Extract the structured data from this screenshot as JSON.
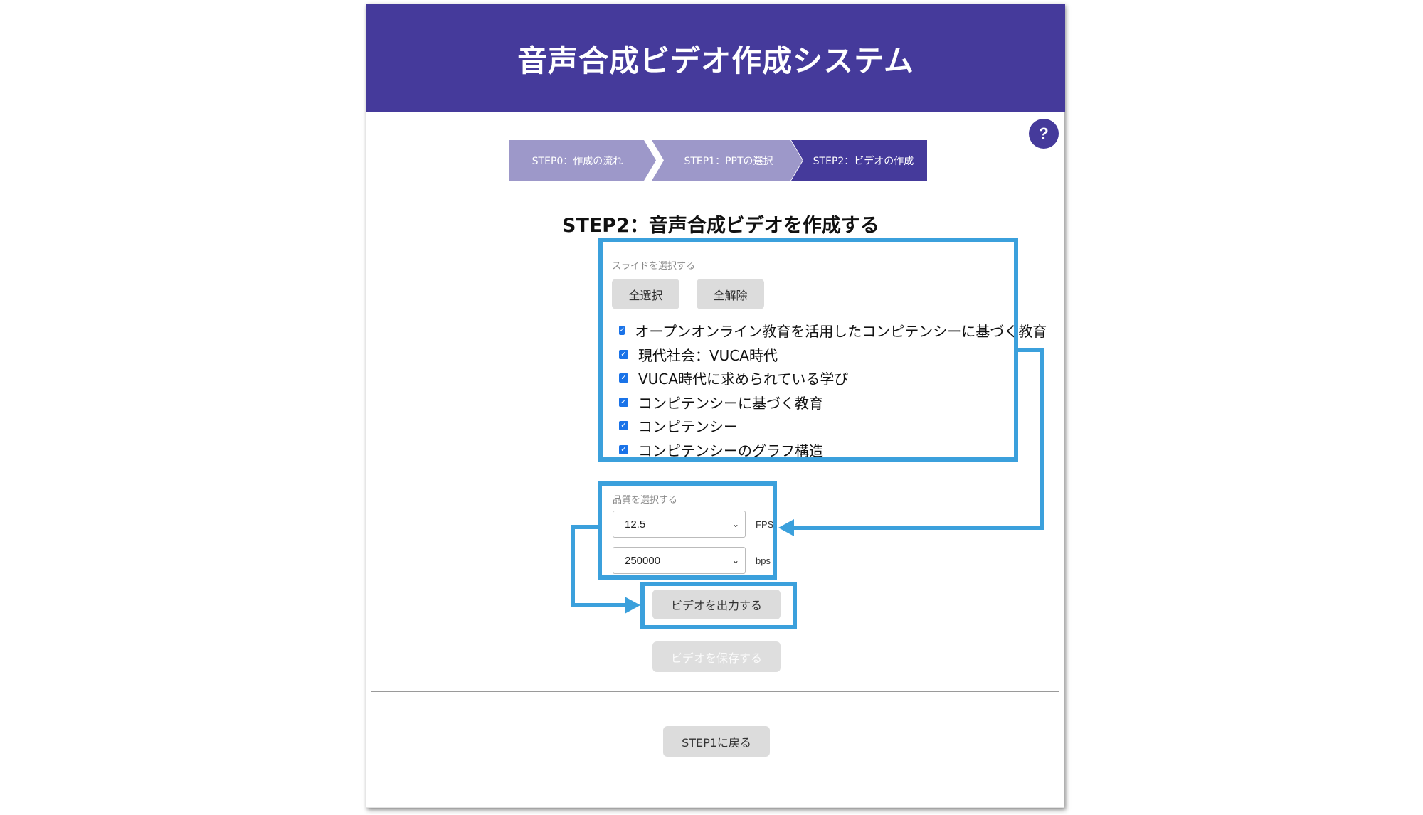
{
  "header": {
    "title": "音声合成ビデオ作成システム"
  },
  "help": {
    "label": "?"
  },
  "steps": [
    {
      "label": "STEP0：作成の流れ",
      "active": false
    },
    {
      "label": "STEP1：PPTの選択",
      "active": false
    },
    {
      "label": "STEP2：ビデオの作成",
      "active": true
    }
  ],
  "section": {
    "title": "STEP2：音声合成ビデオを作成する"
  },
  "slides": {
    "label": "スライドを選択する",
    "select_all": "全選択",
    "deselect_all": "全解除",
    "items": [
      {
        "label": "オープンオンライン教育を活用したコンピテンシーに基づく教育",
        "checked": true
      },
      {
        "label": "現代社会：VUCA時代",
        "checked": true
      },
      {
        "label": "VUCA時代に求められている学び",
        "checked": true
      },
      {
        "label": "コンピテンシーに基づく教育",
        "checked": true
      },
      {
        "label": "コンピテンシー",
        "checked": true
      },
      {
        "label": "コンピテンシーのグラフ構造",
        "checked": true
      }
    ]
  },
  "quality": {
    "label": "品質を選択する",
    "fps_value": "12.5",
    "fps_unit": "FPS",
    "bps_value": "250000",
    "bps_unit": "bps"
  },
  "actions": {
    "export_video": "ビデオを出力する",
    "save_video": "ビデオを保存する",
    "back": "STEP1に戻る"
  },
  "colors": {
    "brand": "#453a9b",
    "step_inactive": "#9d98c9",
    "annotation": "#3ba0dc",
    "checkbox": "#1a73e8"
  }
}
